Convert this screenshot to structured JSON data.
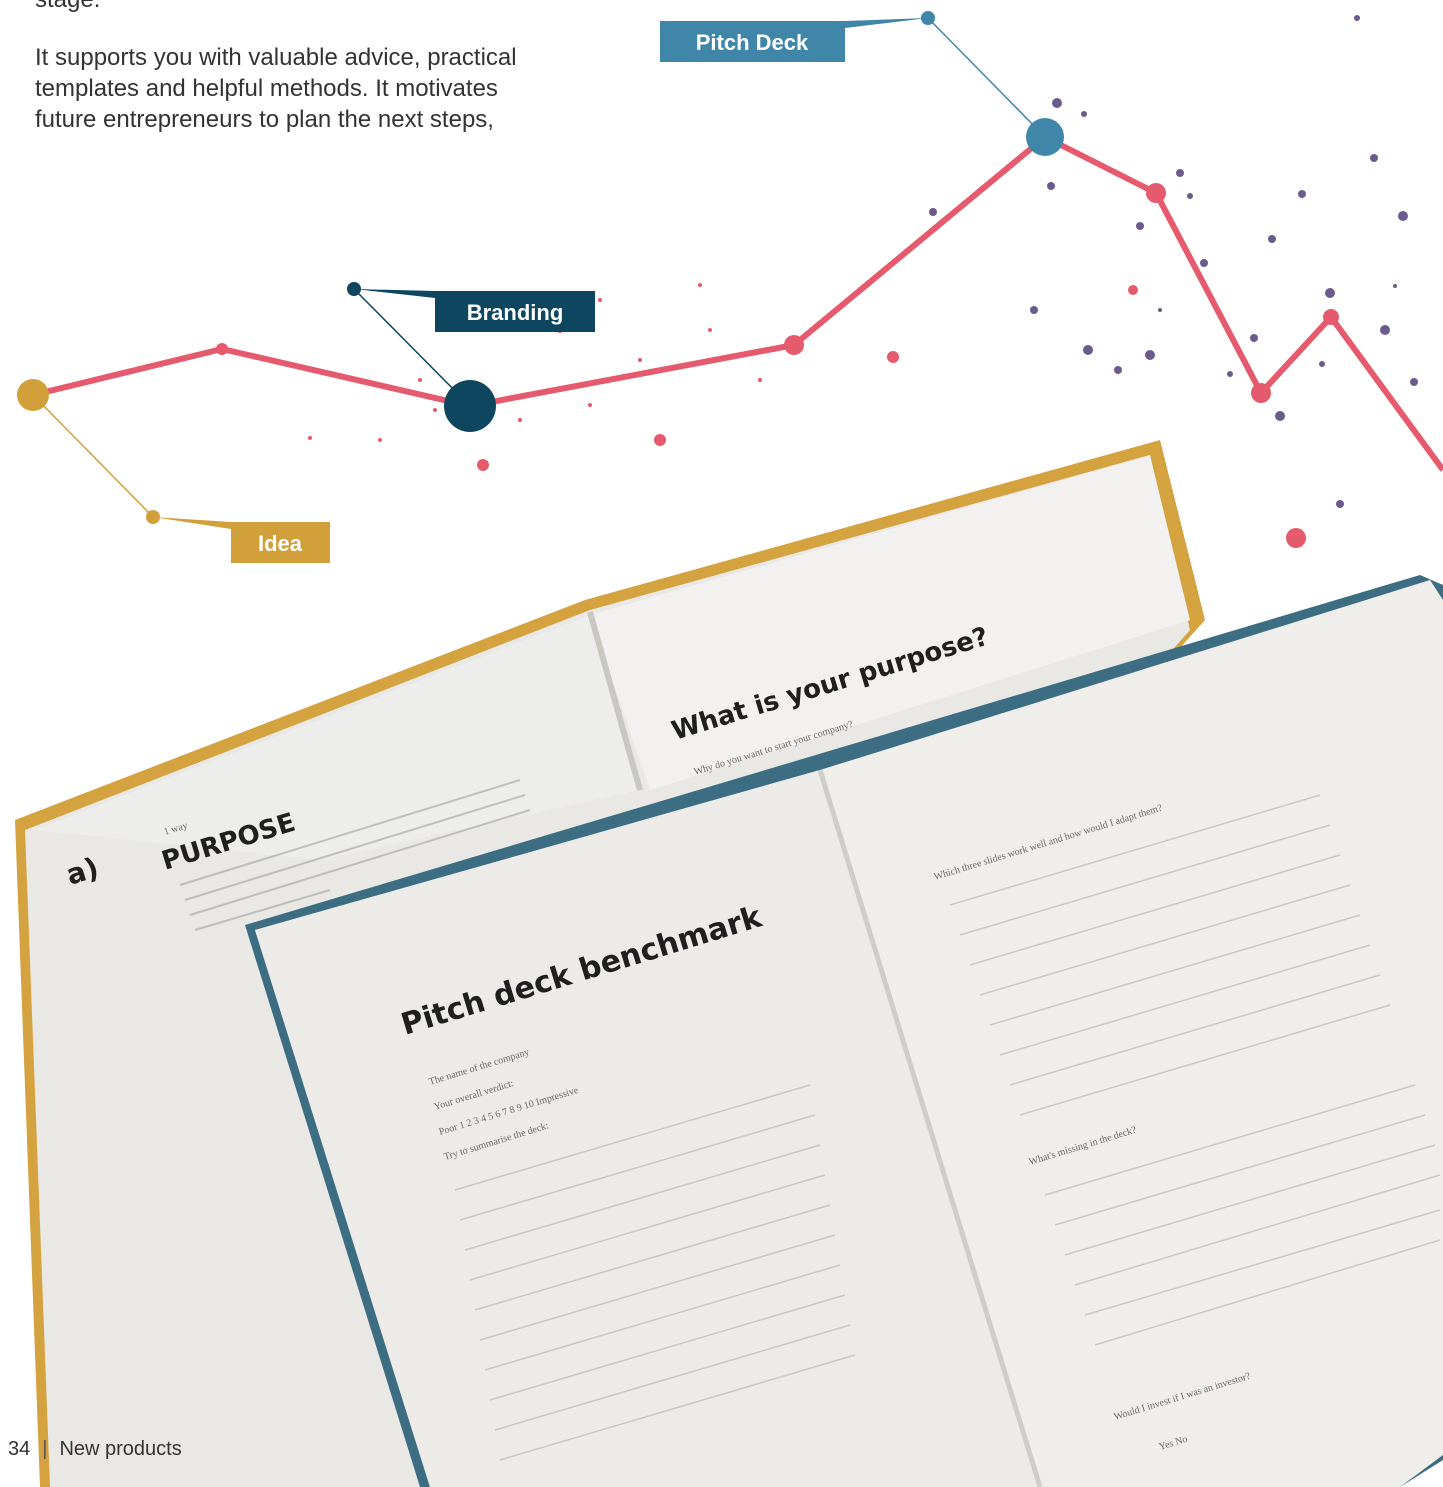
{
  "intro": {
    "line_partial": "stage.",
    "lines": [
      "It supports you with valuable advice, practical",
      "templates and helpful methods. It motivates",
      "future entrepreneurs to plan the next steps,"
    ]
  },
  "milestones": [
    {
      "label": "Idea",
      "color": "#d2a03a"
    },
    {
      "label": "Branding",
      "color": "#0e4660"
    },
    {
      "label": "Pitch Deck",
      "color": "#3f86a8"
    }
  ],
  "line_color": "#e55a6c",
  "notebook_back": {
    "left_page_marker": "a)",
    "left_page_small": "1 way",
    "left_page_title": "PURPOSE",
    "right_page_title": "What is your purpose?",
    "right_page_prompt": "Why do you want to start your company?"
  },
  "notebook_front": {
    "left_title": "Pitch deck benchmark",
    "left_lines": [
      "The name of the company",
      "Your overall verdict:",
      "Poor  1  2  3  4  5  6  7  8  9  10  Impressive",
      "Try to summarise the deck:"
    ],
    "right_lines": [
      "Which three slides work well and how would I adapt them?",
      "What's missing in the deck?",
      "Would I invest if I was an investor?",
      "Yes     No"
    ]
  },
  "footer": {
    "page_number": "34",
    "separator": "|",
    "section": "New products"
  }
}
